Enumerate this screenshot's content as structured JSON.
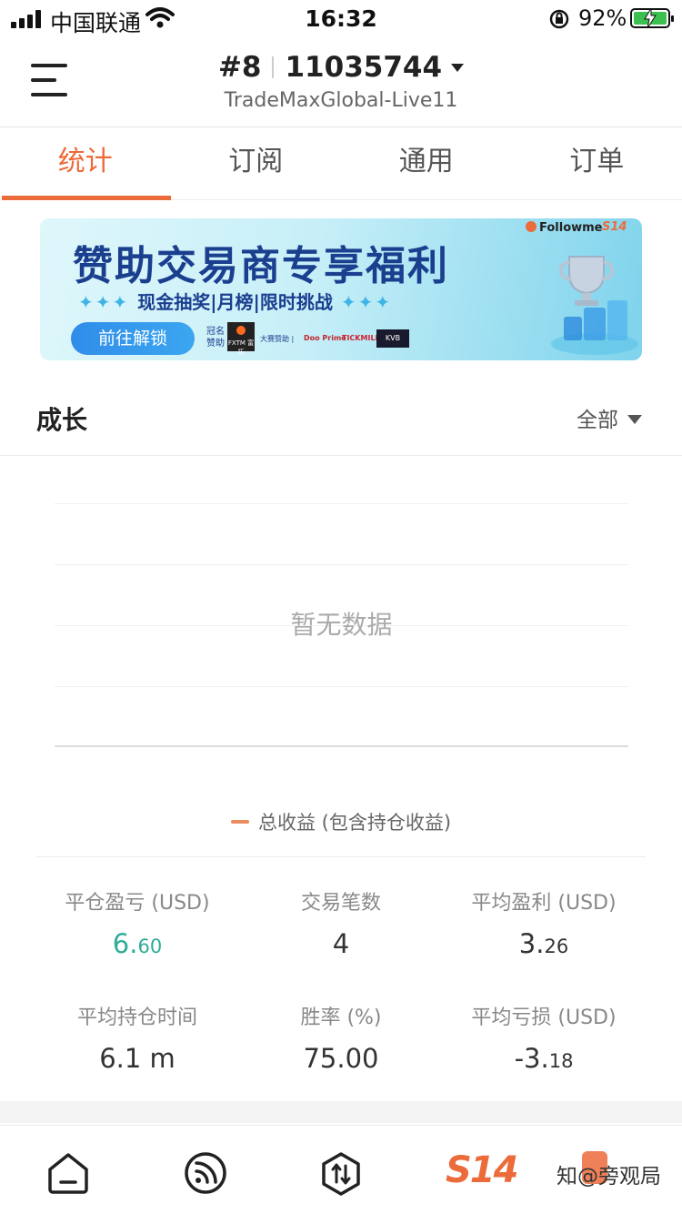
{
  "status_bar": {
    "carrier": "中国联通",
    "time": "16:32",
    "battery_percent": "92%"
  },
  "header": {
    "account_index": "#8",
    "account_number": "11035744",
    "server": "TradeMaxGlobal-Live11"
  },
  "tabs": [
    {
      "label": "统计",
      "active": true
    },
    {
      "label": "订阅",
      "active": false
    },
    {
      "label": "通用",
      "active": false
    },
    {
      "label": "订单",
      "active": false
    }
  ],
  "banner": {
    "title": "赞助交易商专享福利",
    "subtitle": "现金抽奖|月榜|限时挑战",
    "button_label": "前往解锁",
    "sponsor_label": "冠名赞助",
    "fxtm": "FXTM 富拓",
    "event_sponsors": "大赛赞助 |",
    "brand_1": "Doo Prime",
    "brand_2": "TICKMILL",
    "brand_3": "KVB",
    "brand": "Followme",
    "event": "S14"
  },
  "growth": {
    "title": "成长",
    "filter_label": "全部"
  },
  "chart_data": {
    "type": "line",
    "empty_text": "暂无数据",
    "series": [
      {
        "name": "总收益 (包含持仓收益)",
        "values": []
      }
    ],
    "grid": true,
    "legend_position": "bottom",
    "color": "#ec8a5e"
  },
  "stats": [
    {
      "label": "平仓盈亏 (USD)",
      "int": "6.",
      "dec": "60",
      "highlight": true
    },
    {
      "label": "交易笔数",
      "int": "4",
      "dec": "",
      "highlight": false
    },
    {
      "label": "平均盈利 (USD)",
      "int": "3.",
      "dec": "26",
      "highlight": false
    },
    {
      "label": "平均持仓时间",
      "int": "6.1 m",
      "dec": "",
      "highlight": false
    },
    {
      "label": "胜率 (%)",
      "int": "75.00",
      "dec": "",
      "highlight": false
    },
    {
      "label": "平均亏损 (USD)",
      "int": "-3.",
      "dec": "18",
      "highlight": false
    }
  ],
  "bottom_nav": {
    "items": [
      "home-icon",
      "feed-icon",
      "trade-icon",
      "s14-logo"
    ],
    "s14_label": "S14",
    "watermark": "知@旁观局"
  },
  "colors": {
    "accent": "#ec6b3b",
    "profit": "#2eac98"
  }
}
